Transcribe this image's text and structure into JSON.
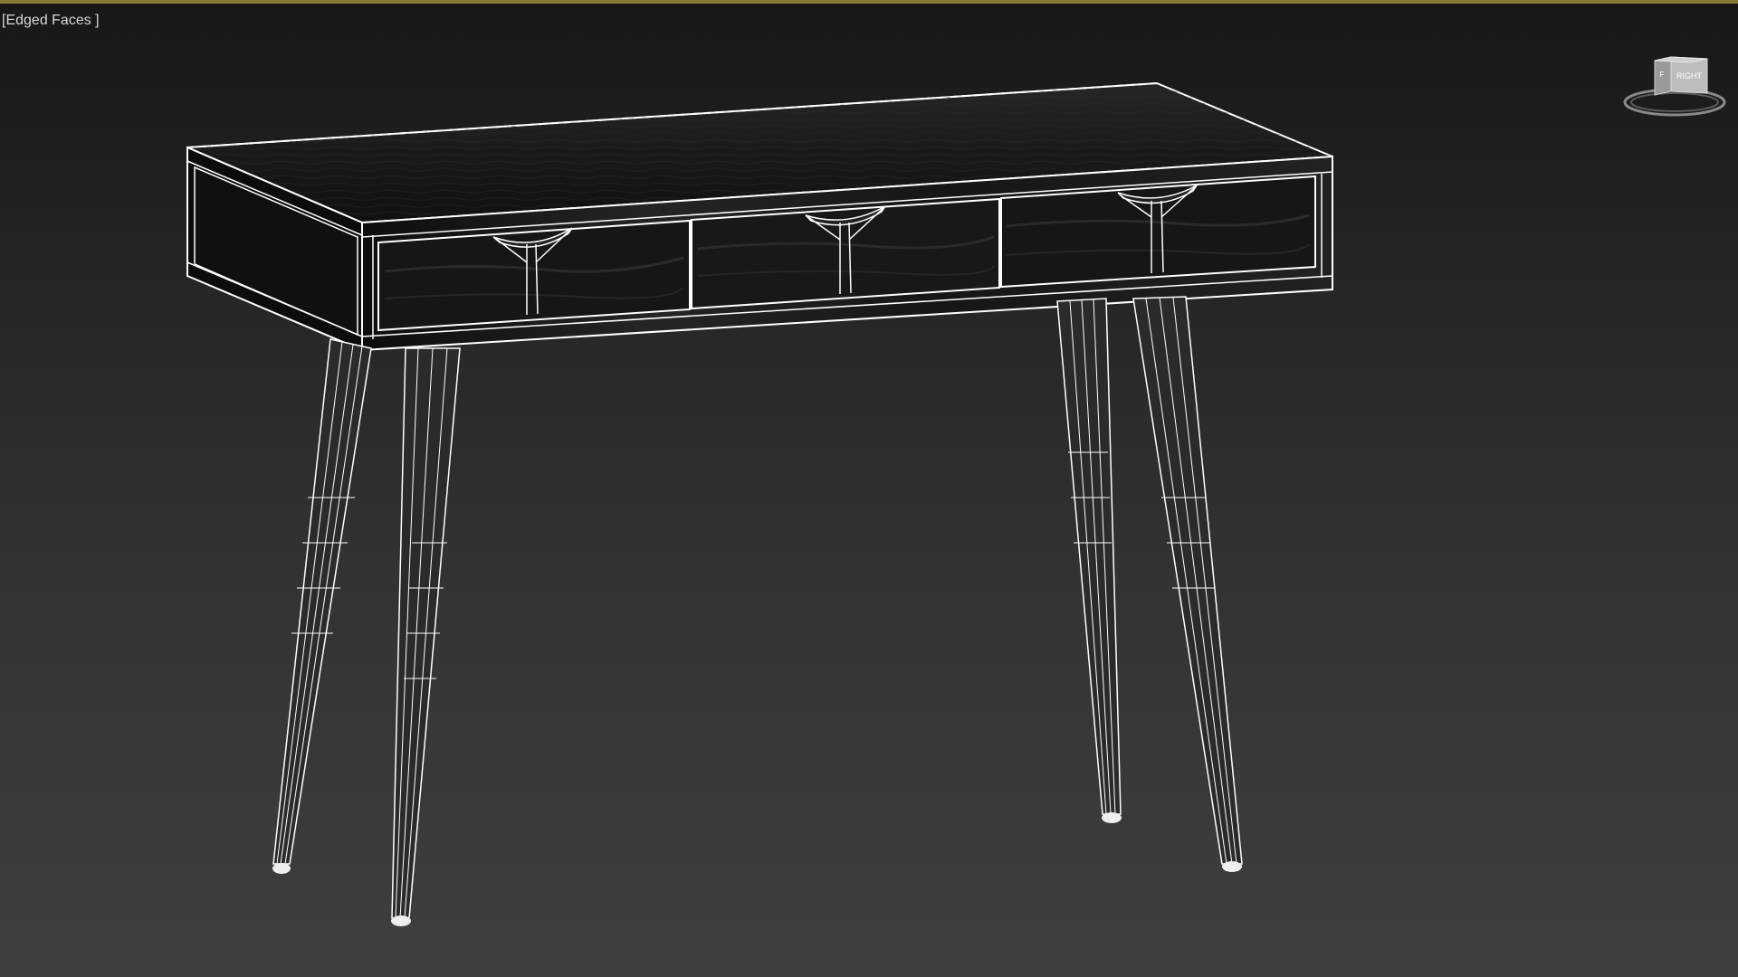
{
  "viewport": {
    "label": "[Edged Faces ]",
    "active_border_color": "#8a7838"
  },
  "viewcube": {
    "face_label": "RIGHT",
    "side_label": "F"
  },
  "scene": {
    "object": "console-table",
    "wire_color": "#ffffff",
    "wood_color": "#151515"
  }
}
